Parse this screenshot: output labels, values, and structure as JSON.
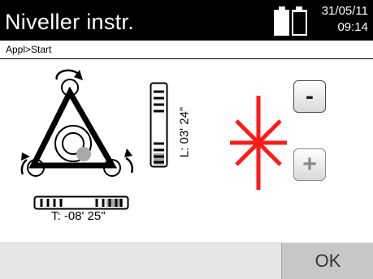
{
  "header": {
    "title": "Niveller instr.",
    "date": "31/05/11",
    "time": "09:14"
  },
  "breadcrumb": "Appl>Start",
  "tilt": {
    "longitudinal_label": "L: 03' 24\"",
    "transverse_label": "T: -08' 25\""
  },
  "controls": {
    "minus_label": "-",
    "plus_label": "+",
    "plus_enabled": false
  },
  "footer": {
    "ok_label": "OK"
  },
  "colors": {
    "laser": "#ff1a1a",
    "title_bar": "#000000",
    "bubble": "#a9a9a9"
  },
  "icons": [
    "battery-icon",
    "leveling-triangle-icon",
    "rotate-arrow-icon",
    "laser-star-icon",
    "minus-icon",
    "plus-icon"
  ]
}
